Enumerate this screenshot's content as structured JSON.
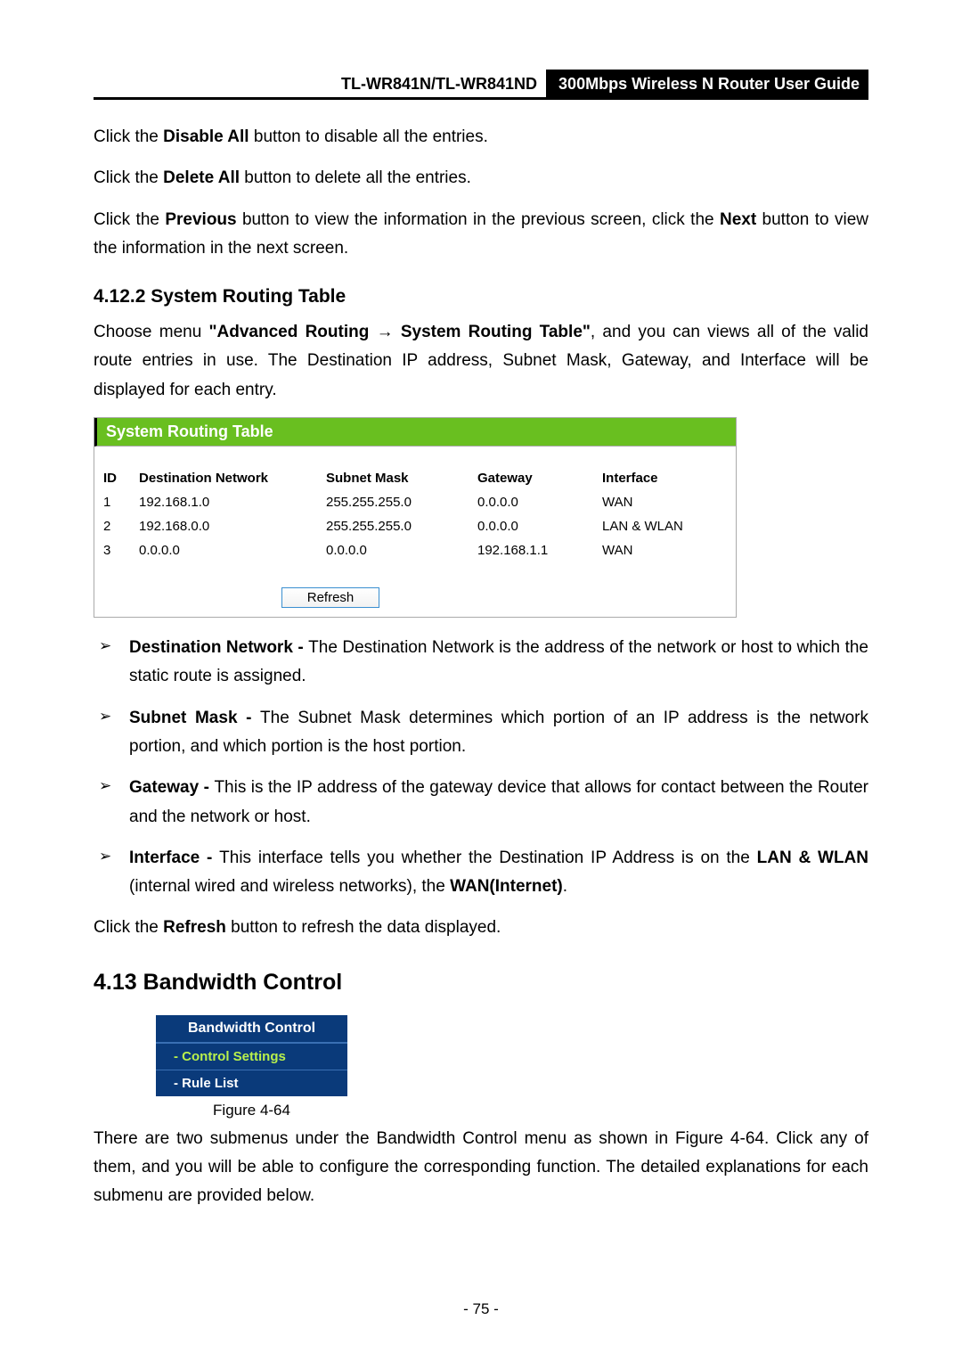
{
  "header": {
    "model": "TL-WR841N/TL-WR841ND",
    "title": "300Mbps Wireless N Router User Guide"
  },
  "intro": {
    "p1a": "Click the ",
    "p1b": "Disable All",
    "p1c": " button to disable all the entries.",
    "p2a": "Click the ",
    "p2b": "Delete All",
    "p2c": " button to delete all the entries.",
    "p3a": "Click the ",
    "p3b": "Previous",
    "p3c": " button to view the information in the previous screen, click the ",
    "p3d": "Next",
    "p3e": " button to view the information in the next screen."
  },
  "sec412": {
    "heading": "4.12.2 System Routing Table",
    "p1a": "Choose menu ",
    "p1b": "\"Advanced Routing → System Routing Table\"",
    "p1c": ", and you can views all of the valid route entries in use. The Destination IP address, Subnet Mask, Gateway, and Interface will be displayed for each entry.",
    "fig_title": "System Routing Table",
    "table": {
      "headers": {
        "id": "ID",
        "dest": "Destination Network",
        "mask": "Subnet Mask",
        "gw": "Gateway",
        "iface": "Interface"
      },
      "rows": [
        {
          "id": "1",
          "dest": "192.168.1.0",
          "mask": "255.255.255.0",
          "gw": "0.0.0.0",
          "iface": "WAN"
        },
        {
          "id": "2",
          "dest": "192.168.0.0",
          "mask": "255.255.255.0",
          "gw": "0.0.0.0",
          "iface": "LAN & WLAN"
        },
        {
          "id": "3",
          "dest": "0.0.0.0",
          "mask": "0.0.0.0",
          "gw": "192.168.1.1",
          "iface": "WAN"
        }
      ]
    },
    "refresh_label": "Refresh",
    "bullets": {
      "b1a": "Destination Network - ",
      "b1b": "The Destination Network is the address of the network or host to which the static route is assigned.",
      "b2a": "Subnet Mask - ",
      "b2b": "The Subnet Mask determines which portion of an IP address is the network portion, and which portion is the host portion.",
      "b3a": "Gateway - ",
      "b3b": "This is the IP address of the gateway device that allows for contact between the Router and the network or host.",
      "b4a": "Interface - ",
      "b4b": "This interface tells you whether the Destination IP Address is on the ",
      "b4c": "LAN & WLAN",
      "b4d": " (internal wired and wireless networks), the ",
      "b4e": "WAN(Internet)",
      "b4f": "."
    },
    "refresh_note_a": "Click the ",
    "refresh_note_b": "Refresh",
    "refresh_note_c": " button to refresh the data displayed."
  },
  "sec413": {
    "heading": "4.13  Bandwidth Control",
    "menu": {
      "header": "Bandwidth Control",
      "item1": "- Control Settings",
      "item2": "- Rule List"
    },
    "caption": "Figure 4-64",
    "p1": "There are two submenus under the Bandwidth Control menu as shown in Figure 4-64. Click any of them, and you will be able to configure the corresponding function. The detailed explanations for each submenu are provided below."
  },
  "page_number": "- 75 -"
}
